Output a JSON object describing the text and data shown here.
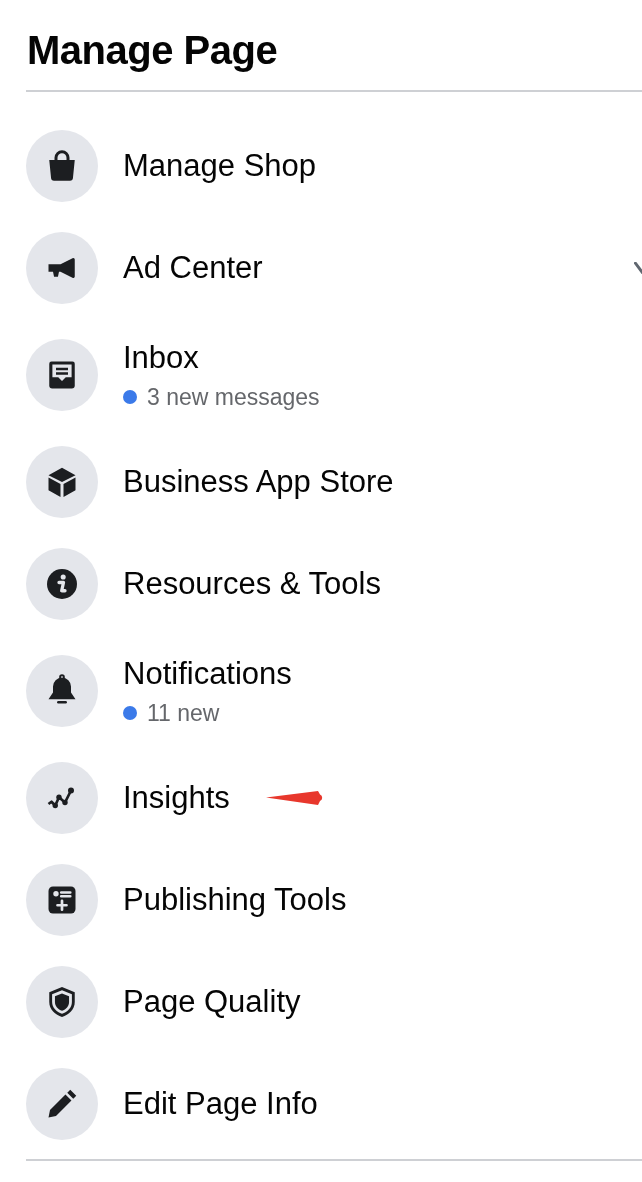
{
  "title": "Manage Page",
  "items": [
    {
      "label": "Manage Shop"
    },
    {
      "label": "Ad Center"
    },
    {
      "label": "Inbox",
      "status": {
        "text": "3 new messages",
        "unread": true
      }
    },
    {
      "label": "Business App Store"
    },
    {
      "label": "Resources & Tools"
    },
    {
      "label": "Notifications",
      "status": {
        "text": "11 new",
        "unread": true
      }
    },
    {
      "label": "Insights",
      "pointed_at": true
    },
    {
      "label": "Publishing Tools"
    },
    {
      "label": "Page Quality"
    },
    {
      "label": "Edit Page Info"
    }
  ]
}
